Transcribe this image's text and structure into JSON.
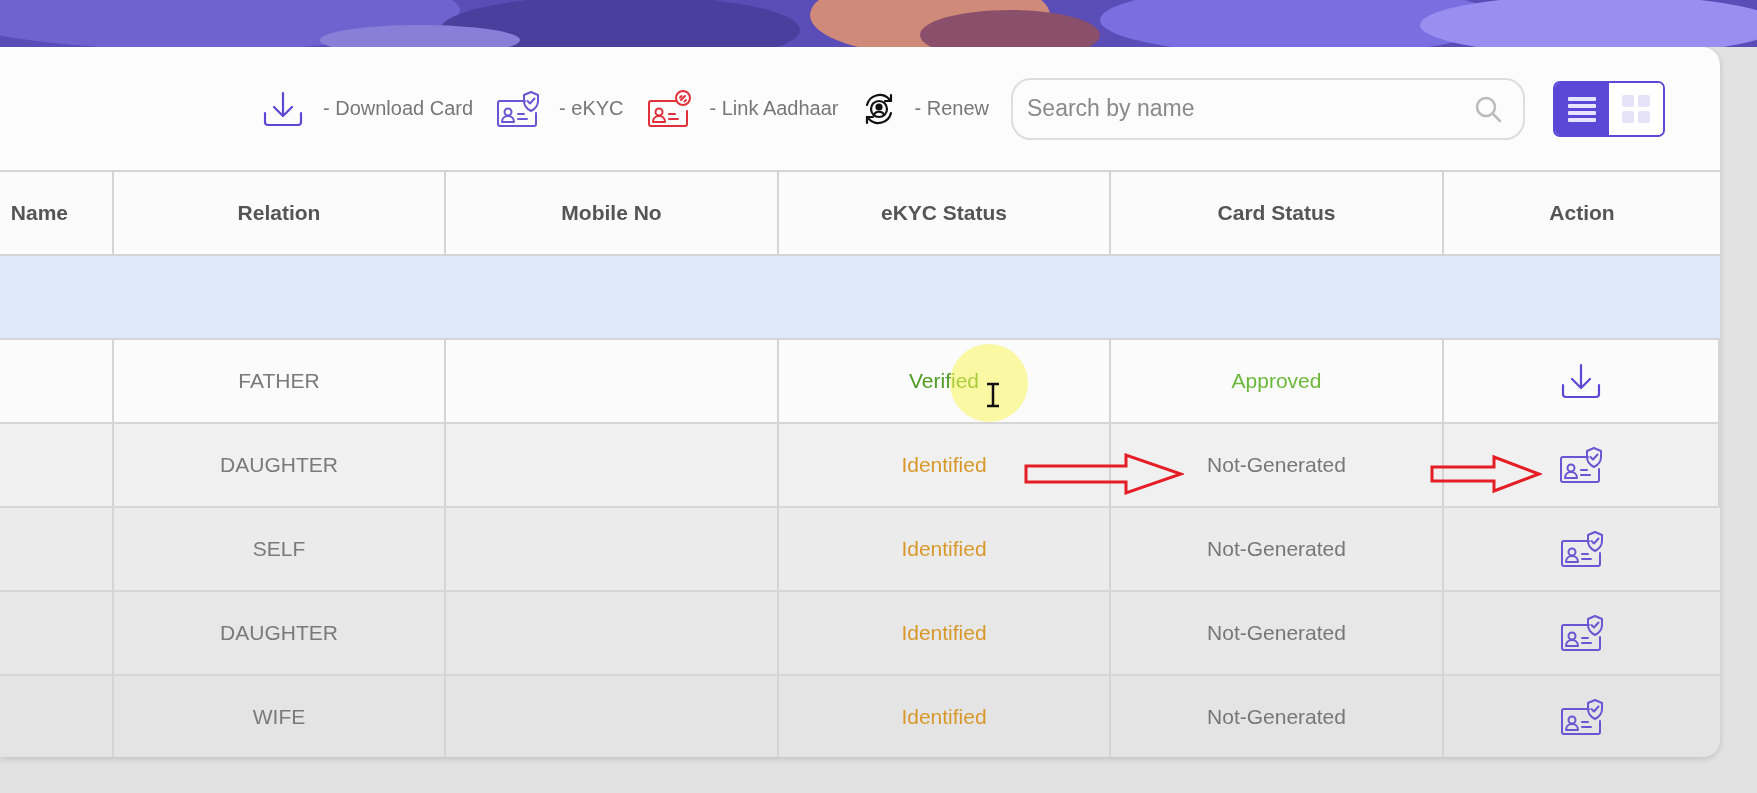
{
  "legend": [
    {
      "kind": "download",
      "label": "- Download Card"
    },
    {
      "kind": "ekyc",
      "label": "- eKYC"
    },
    {
      "kind": "link",
      "label": "- Link Aadhaar"
    },
    {
      "kind": "renew",
      "label": "- Renew"
    }
  ],
  "search": {
    "placeholder": "Search by name"
  },
  "view_toggle": [
    {
      "kind": "list",
      "selected": true
    },
    {
      "kind": "grid",
      "selected": false
    }
  ],
  "table": {
    "columns": [
      "Name",
      "Relation",
      "Mobile No",
      "eKYC Status",
      "Card Status",
      "Action"
    ],
    "highlight_row": true,
    "rows": [
      {
        "relation": "FATHER",
        "ekyc_status": {
          "text": "Verified",
          "kind": "verified"
        },
        "card_status": {
          "text": "Approved",
          "kind": "approved"
        },
        "action": {
          "kind": "download"
        },
        "cursor": true,
        "annotated": false
      },
      {
        "relation": "DAUGHTER",
        "ekyc_status": {
          "text": "Identified",
          "kind": "identified"
        },
        "card_status": {
          "text": "Not-Generated",
          "kind": "pending"
        },
        "action": {
          "kind": "ekyc"
        },
        "cursor": false,
        "annotated": true
      },
      {
        "relation": "SELF",
        "ekyc_status": {
          "text": "Identified",
          "kind": "identified"
        },
        "card_status": {
          "text": "Not-Generated",
          "kind": "pending"
        },
        "action": {
          "kind": "ekyc"
        },
        "cursor": false,
        "annotated": false
      },
      {
        "relation": "DAUGHTER",
        "ekyc_status": {
          "text": "Identified",
          "kind": "identified"
        },
        "card_status": {
          "text": "Not-Generated",
          "kind": "pending"
        },
        "action": {
          "kind": "ekyc"
        },
        "cursor": false,
        "annotated": false
      },
      {
        "relation": "WIFE",
        "ekyc_status": {
          "text": "Identified",
          "kind": "identified"
        },
        "card_status": {
          "text": "Not-Generated",
          "kind": "pending"
        },
        "action": {
          "kind": "ekyc"
        },
        "cursor": false,
        "annotated": false
      }
    ]
  }
}
